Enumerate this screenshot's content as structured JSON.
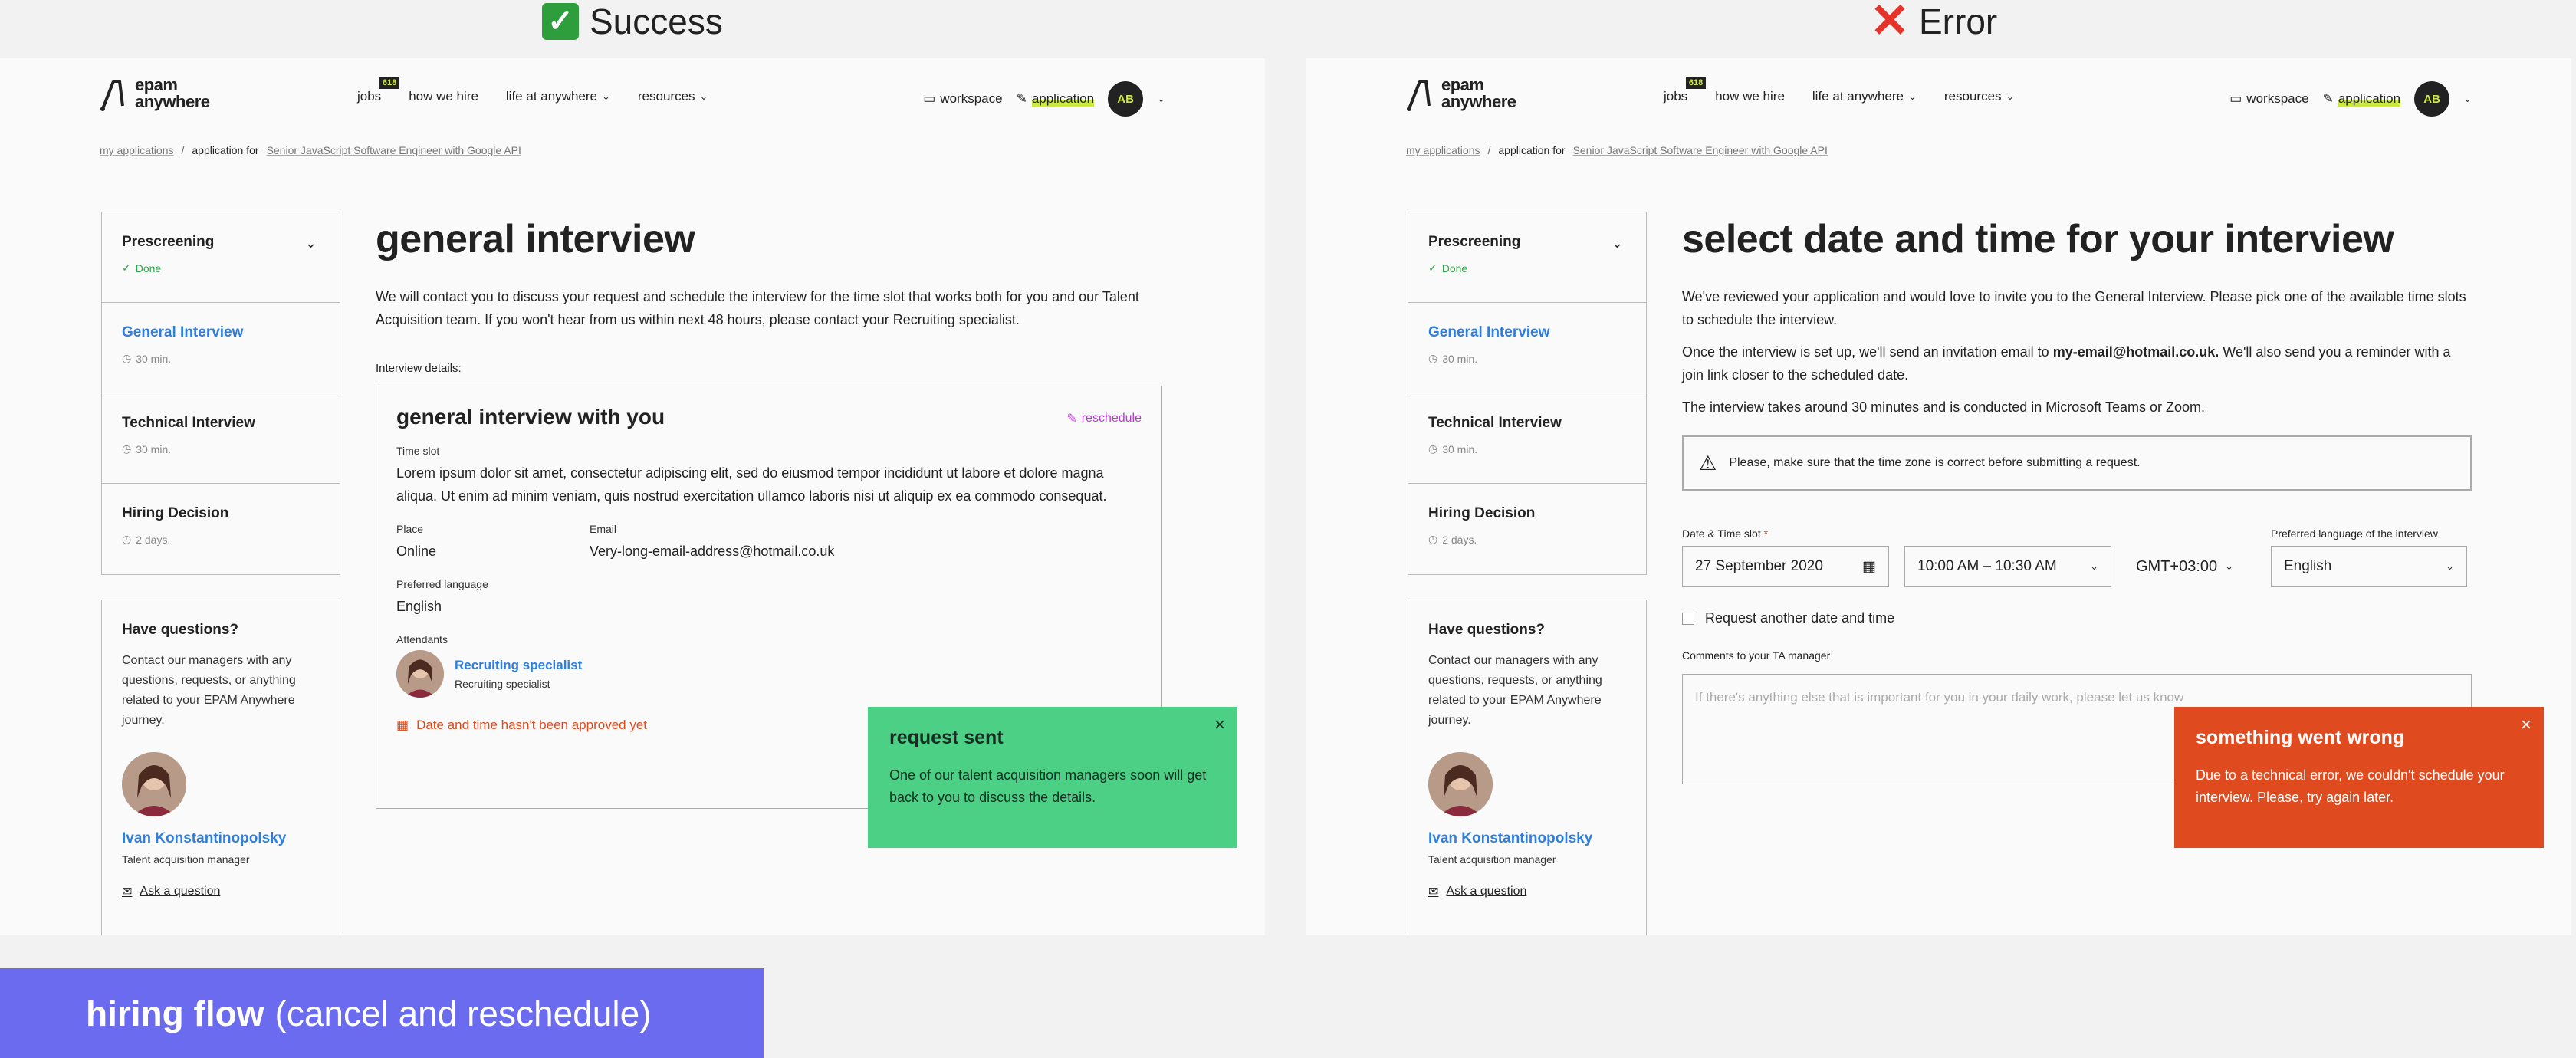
{
  "captions": {
    "success": "Success",
    "error": "Error"
  },
  "header": {
    "logo_top": "epam",
    "logo_bottom": "anywhere",
    "nav": {
      "jobs": "jobs",
      "jobs_badge": "618",
      "how_we_hire": "how we hire",
      "life_at_anywhere": "life at anywhere",
      "resources": "resources"
    },
    "workspace": "workspace",
    "application": "application",
    "avatar_initials": "AB"
  },
  "breadcrumb": {
    "my_applications": "my applications",
    "separator": "/",
    "application_for": "application for",
    "position": "Senior JavaScript Software Engineer with Google API"
  },
  "steps": [
    {
      "title": "Prescreening",
      "sub": "Done"
    },
    {
      "title": "General Interview",
      "sub": "30 min."
    },
    {
      "title": "Technical Interview",
      "sub": "30 min."
    },
    {
      "title": "Hiring Decision",
      "sub": "2 days."
    }
  ],
  "help": {
    "title": "Have questions?",
    "text": "Contact our managers with any questions, requests, or anything related to your EPAM Anywhere journey.",
    "name": "Ivan Konstantinopolsky",
    "role": "Talent acquisition manager",
    "ask": "Ask a question"
  },
  "success": {
    "title": "general interview",
    "intro": "We will contact you to discuss your request and schedule the interview for the time slot that works both for you and our Talent Acquisition team. If you won't hear from us within next 48 hours, please contact your Recruiting specialist.",
    "details_label": "Interview details:",
    "card_title": "general interview with you",
    "reschedule": "reschedule",
    "time_slot_label": "Time slot",
    "time_slot_value": "Lorem ipsum dolor sit amet, consectetur adipiscing elit, sed do eiusmod tempor incididunt ut labore et dolore magna aliqua. Ut enim ad minim veniam, quis nostrud exercitation ullamco laboris nisi ut aliquip ex ea commodo consequat.",
    "place_label": "Place",
    "place_value": "Online",
    "email_label": "Email",
    "email_value": "Very-long-email-address@hotmail.co.uk",
    "language_label": "Preferred language",
    "language_value": "English",
    "attendants_label": "Attendants",
    "attendant_name": "Recruiting specialist",
    "attendant_role": "Recruiting specialist",
    "warning": "Date and time hasn't been approved yet",
    "toast_title": "request sent",
    "toast_body": "One of our talent acquisition managers soon will get back to you to discuss the details.",
    "toast_close": "×"
  },
  "error": {
    "title": "select date and time for your interview",
    "p1": "We've reviewed your application and would love to invite you to the General Interview. Please pick one of the available time slots to schedule the interview.",
    "p2_pre": "Once the interview is set up, we'll send an invitation email to ",
    "p2_email": "my-email@hotmail.co.uk.",
    "p2_post": " We'll also send you a reminder with a join link closer to the scheduled date.",
    "p3": "The interview takes around 30 minutes and is conducted in Microsoft Teams or Zoom.",
    "notice": "Please, make sure that the time zone is correct before submitting a request.",
    "date_label": "Date & Time slot",
    "date_required": "*",
    "date_value": "27 September 2020",
    "time_value": "10:00 AM – 10:30 AM",
    "timezone": "GMT+03:00",
    "lang_label": "Preferred language of the interview",
    "lang_value": "English",
    "checkbox_label": "Request another date and time",
    "comments_label": "Comments to your TA manager",
    "comments_placeholder": "If there's anything else that is important for you in your daily work, please let us know",
    "toast_title": "something went wrong",
    "toast_body": "Due to a technical error, we couldn't schedule your interview. Please, try again later.",
    "toast_close": "×"
  },
  "footer": {
    "bold": "hiring flow",
    "rest": "(cancel and reschedule)"
  },
  "colors": {
    "accent_blue": "#2e7ee0",
    "success": "#4bd086",
    "error": "#e04a1f",
    "highlight": "#cbe940",
    "banner": "#6b6bf0"
  }
}
